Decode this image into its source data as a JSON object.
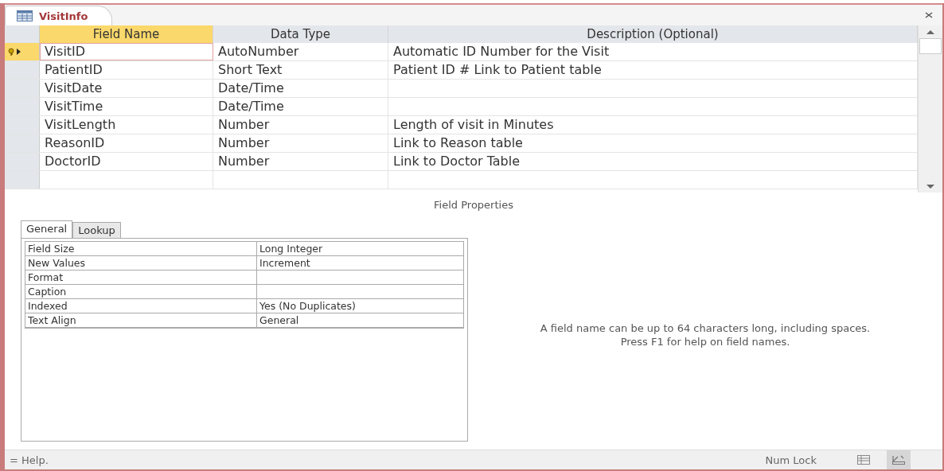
{
  "document_tab": {
    "title": "VisitInfo"
  },
  "table": {
    "columns": [
      "Field Name",
      "Data Type",
      "Description (Optional)"
    ],
    "rows": [
      {
        "field_name": "VisitID",
        "data_type": "AutoNumber",
        "description": "Automatic ID Number for the Visit",
        "selected": true,
        "primary_key": true
      },
      {
        "field_name": "PatientID",
        "data_type": "Short Text",
        "description": "Patient ID # Link to Patient table",
        "selected": false,
        "primary_key": false
      },
      {
        "field_name": "VisitDate",
        "data_type": "Date/Time",
        "selected": false,
        "primary_key": false
      },
      {
        "field_name": "VisitTime",
        "data_type": "Date/Time",
        "selected": false,
        "primary_key": false
      },
      {
        "field_name": "VisitLength",
        "data_type": "Number",
        "description": "Length of visit in Minutes",
        "selected": false,
        "primary_key": false
      },
      {
        "field_name": "ReasonID",
        "data_type": "Number",
        "description": "Link to Reason table",
        "selected": false,
        "primary_key": false
      },
      {
        "field_name": "DoctorID",
        "data_type": "Number",
        "description": "Link to Doctor Table",
        "selected": false,
        "primary_key": false
      }
    ]
  },
  "field_properties": {
    "title": "Field Properties",
    "tabs": [
      {
        "label": "General",
        "selected": true
      },
      {
        "label": "Lookup",
        "selected": false
      }
    ],
    "properties": [
      {
        "name": "Field Size",
        "value": "Long Integer"
      },
      {
        "name": "New Values",
        "value": "Increment"
      },
      {
        "name": "Format"
      },
      {
        "name": "Caption"
      },
      {
        "name": "Indexed",
        "value": "Yes (No Duplicates)"
      },
      {
        "name": "Text Align",
        "value": "General"
      }
    ],
    "help_text": "A field name can be up to 64 characters long, including spaces. Press F1 for help on field names."
  },
  "status_bar": {
    "text": "= Help.",
    "indicator": "Num Lock"
  }
}
